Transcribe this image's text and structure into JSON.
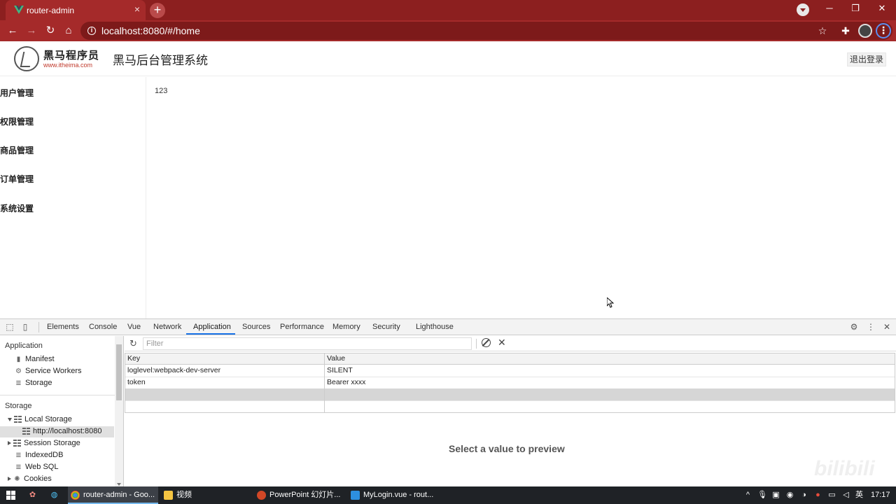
{
  "browser": {
    "tab_title": "router-admin",
    "tab_close": "×",
    "new_tab": "+",
    "url": "localhost:8080/#/home"
  },
  "app": {
    "brand_name": "黑马程序员",
    "brand_url": "www.itheima.com",
    "system_title": "黑马后台管理系统",
    "logout_label": "退出登录",
    "sidebar": [
      {
        "label": "用户管理"
      },
      {
        "label": "权限管理"
      },
      {
        "label": "商品管理"
      },
      {
        "label": "订单管理"
      },
      {
        "label": "系统设置"
      }
    ],
    "main_content": "123"
  },
  "devtools": {
    "tabs": [
      "Elements",
      "Console",
      "Vue",
      "Network",
      "Application",
      "Sources",
      "Performance",
      "Memory",
      "Security",
      "Lighthouse"
    ],
    "active_tab": "Application",
    "sidebar": {
      "application_section": "Application",
      "application_items": [
        "Manifest",
        "Service Workers",
        "Storage"
      ],
      "storage_section": "Storage",
      "local_storage": "Local Storage",
      "local_storage_origin": "http://localhost:8080",
      "storage_items": [
        "Session Storage",
        "IndexedDB",
        "Web SQL",
        "Cookies"
      ]
    },
    "filter_placeholder": "Filter",
    "table": {
      "headers": {
        "key": "Key",
        "value": "Value"
      },
      "rows": [
        {
          "key": "loglevel:webpack-dev-server",
          "value": "SILENT"
        },
        {
          "key": "token",
          "value": "Bearer xxxx"
        }
      ]
    },
    "preview_message": "Select a value to preview"
  },
  "watermark": "bilibili",
  "taskbar": {
    "apps": [
      {
        "label": "router-admin - Goo..."
      },
      {
        "label": "视频"
      },
      {
        "label": "PowerPoint 幻灯片..."
      },
      {
        "label": "MyLogin.vue - rout..."
      }
    ],
    "ime": "英",
    "time": "17:17"
  },
  "colors": {
    "browser_theme": "#a52a2a",
    "devtools_accent": "#1a73e8"
  }
}
